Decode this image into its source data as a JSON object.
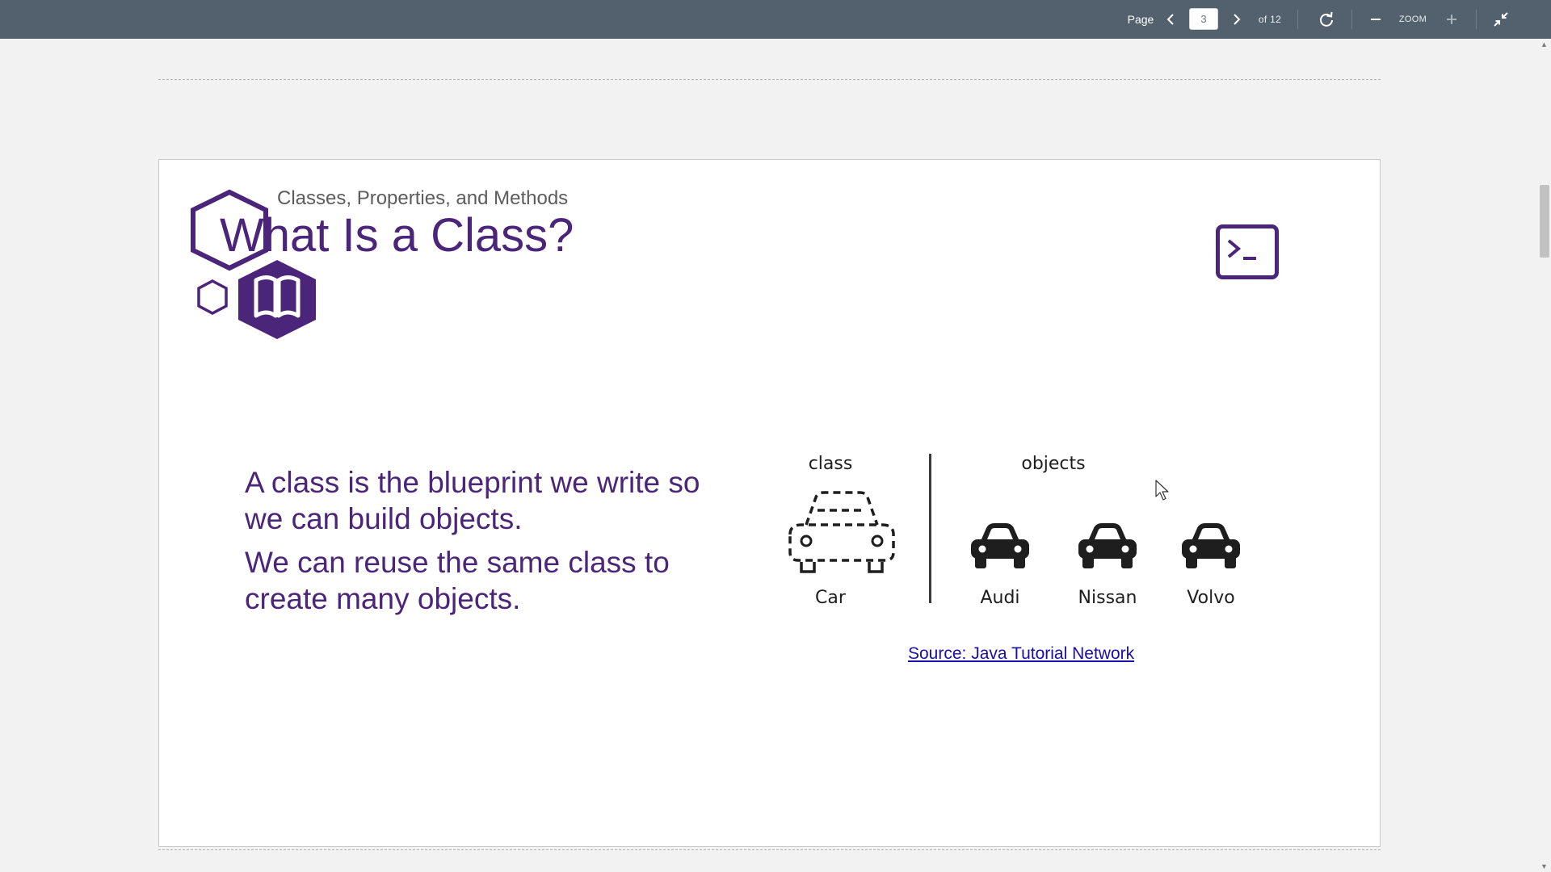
{
  "toolbar": {
    "page_label": "Page",
    "current_page": "3",
    "total_pages": "of 12",
    "zoom_label": "ZOOM",
    "icons": [
      "chevron-left-icon",
      "chevron-right-icon",
      "rotate-icon",
      "minus-icon",
      "plus-icon",
      "collapse-icon"
    ]
  },
  "slide": {
    "subtitle": "Classes, Properties, and Methods",
    "title": "What Is a Class?",
    "paragraphs": [
      "A class is the blueprint we write so we can build objects.",
      "We can reuse the same class to create many objects."
    ],
    "diagram": {
      "class_heading": "class",
      "objects_heading": "objects",
      "class_name": "Car",
      "objects": [
        "Audi",
        "Nissan",
        "Volvo"
      ]
    },
    "source_link": "Source: Java Tutorial Network",
    "colors": {
      "accent": "#4b2579",
      "link": "#1a0dab",
      "toolbar": "#53616e"
    }
  }
}
